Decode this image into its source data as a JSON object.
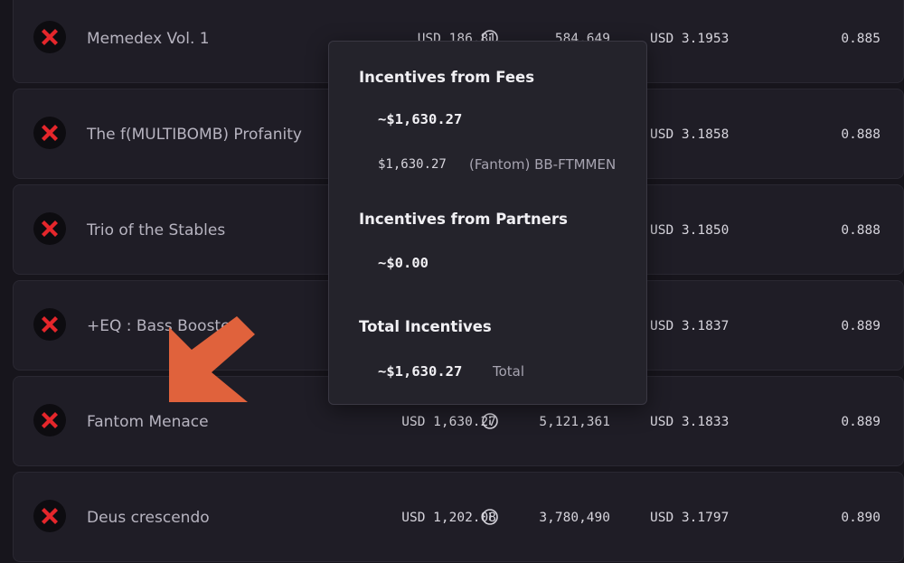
{
  "pools": [
    {
      "name": "Memedex Vol. 1",
      "incentives": "USD 186.81",
      "volume": "584,649",
      "price": "USD 3.1953",
      "ratio": "0.885"
    },
    {
      "name": "The f(MULTIBOMB) Profanity",
      "incentives": "",
      "volume": "",
      "price": "USD 3.1858",
      "ratio": "0.888"
    },
    {
      "name": "Trio of the Stables",
      "incentives": "",
      "volume": "",
      "price": "USD 3.1850",
      "ratio": "0.888"
    },
    {
      "name": "+EQ : Bass Boosted",
      "incentives": "",
      "volume": "",
      "price": "USD 3.1837",
      "ratio": "0.889"
    },
    {
      "name": "Fantom Menace",
      "incentives": "USD 1,630.27",
      "volume": "5,121,361",
      "price": "USD 3.1833",
      "ratio": "0.889"
    },
    {
      "name": "Deus crescendo",
      "incentives": "USD 1,202.08",
      "volume": "3,780,490",
      "price": "USD 3.1797",
      "ratio": "0.890"
    }
  ],
  "tooltip": {
    "fees_heading": "Incentives from Fees",
    "fees_total": "~$1,630.27",
    "fees_item_amount": "$1,630.27",
    "fees_item_label": "(Fantom) BB-FTMMEN",
    "partners_heading": "Incentives from Partners",
    "partners_total": "~$0.00",
    "total_heading": "Total Incentives",
    "total_amount": "~$1,630.27",
    "total_label": "Total"
  },
  "colors": {
    "accent_arrow": "#e0623c",
    "logo_red": "#e5262b"
  },
  "icons": {
    "logo": "red-cross-logo-icon",
    "info": "info-circle-icon",
    "arrow": "down-left-arrow-icon"
  }
}
